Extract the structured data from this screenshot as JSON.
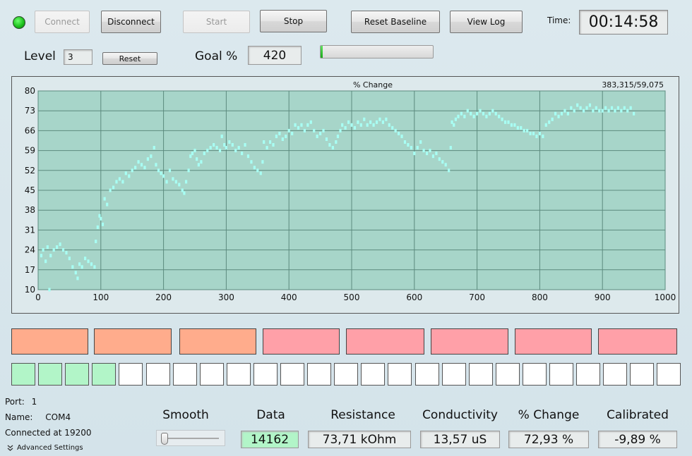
{
  "status": {
    "led_icon": "green-led-icon",
    "led_color": "#1ec21e"
  },
  "toolbar": {
    "connect": "Connect",
    "disconnect": "Disconnect",
    "start": "Start",
    "stop": "Stop",
    "reset_baseline": "Reset Baseline",
    "view_log": "View Log",
    "time_label": "Time:",
    "time_value": "00:14:58"
  },
  "level": {
    "label": "Level",
    "value": "3",
    "reset": "Reset"
  },
  "goal": {
    "label": "Goal %",
    "value": "420",
    "progress_percent": 2
  },
  "chart_data": {
    "type": "scatter",
    "title": "% Change",
    "annotation": "383,315/59,075",
    "xlim": [
      0,
      1000
    ],
    "ylim": [
      10,
      80
    ],
    "x_ticks": [
      0,
      100,
      200,
      300,
      400,
      500,
      600,
      700,
      800,
      900,
      1000
    ],
    "y_ticks": [
      10,
      17,
      24,
      31,
      38,
      45,
      52,
      59,
      66,
      73,
      80
    ],
    "grid": true,
    "series": [
      {
        "color": "#a8fff4",
        "points": [
          [
            5,
            22
          ],
          [
            8,
            24
          ],
          [
            12,
            20
          ],
          [
            15,
            25
          ],
          [
            18,
            10
          ],
          [
            20,
            22
          ],
          [
            25,
            24
          ],
          [
            30,
            25
          ],
          [
            35,
            26
          ],
          [
            40,
            24
          ],
          [
            45,
            23
          ],
          [
            50,
            21
          ],
          [
            55,
            18
          ],
          [
            60,
            16
          ],
          [
            63,
            14
          ],
          [
            66,
            19
          ],
          [
            70,
            18
          ],
          [
            75,
            21
          ],
          [
            80,
            20
          ],
          [
            85,
            19
          ],
          [
            90,
            18
          ],
          [
            92,
            27
          ],
          [
            95,
            32
          ],
          [
            98,
            36
          ],
          [
            100,
            35
          ],
          [
            103,
            33
          ],
          [
            106,
            42
          ],
          [
            110,
            40
          ],
          [
            115,
            45
          ],
          [
            120,
            46
          ],
          [
            125,
            48
          ],
          [
            130,
            49
          ],
          [
            135,
            48
          ],
          [
            140,
            51
          ],
          [
            145,
            50
          ],
          [
            150,
            52
          ],
          [
            155,
            53
          ],
          [
            160,
            55
          ],
          [
            165,
            54
          ],
          [
            170,
            53
          ],
          [
            175,
            56
          ],
          [
            180,
            57
          ],
          [
            185,
            60
          ],
          [
            188,
            54
          ],
          [
            192,
            52
          ],
          [
            196,
            51
          ],
          [
            200,
            50
          ],
          [
            205,
            48
          ],
          [
            210,
            52
          ],
          [
            215,
            49
          ],
          [
            220,
            48
          ],
          [
            225,
            47
          ],
          [
            230,
            45
          ],
          [
            233,
            44
          ],
          [
            236,
            48
          ],
          [
            240,
            52
          ],
          [
            243,
            57
          ],
          [
            246,
            58
          ],
          [
            250,
            59
          ],
          [
            253,
            56
          ],
          [
            256,
            54
          ],
          [
            260,
            55
          ],
          [
            265,
            58
          ],
          [
            270,
            59
          ],
          [
            275,
            60
          ],
          [
            280,
            61
          ],
          [
            285,
            60
          ],
          [
            290,
            59
          ],
          [
            293,
            64
          ],
          [
            297,
            61
          ],
          [
            300,
            60
          ],
          [
            305,
            62
          ],
          [
            310,
            61
          ],
          [
            315,
            59
          ],
          [
            320,
            60
          ],
          [
            325,
            58
          ],
          [
            330,
            61
          ],
          [
            335,
            57
          ],
          [
            340,
            55
          ],
          [
            345,
            53
          ],
          [
            350,
            52
          ],
          [
            355,
            51
          ],
          [
            358,
            55
          ],
          [
            360,
            62
          ],
          [
            365,
            60
          ],
          [
            370,
            62
          ],
          [
            375,
            61
          ],
          [
            380,
            64
          ],
          [
            385,
            65
          ],
          [
            390,
            63
          ],
          [
            395,
            64
          ],
          [
            400,
            66
          ],
          [
            405,
            65
          ],
          [
            410,
            68
          ],
          [
            415,
            67
          ],
          [
            420,
            68
          ],
          [
            425,
            66
          ],
          [
            430,
            68
          ],
          [
            435,
            69
          ],
          [
            440,
            66
          ],
          [
            445,
            64
          ],
          [
            450,
            65
          ],
          [
            455,
            66
          ],
          [
            460,
            63
          ],
          [
            465,
            61
          ],
          [
            470,
            60
          ],
          [
            475,
            62
          ],
          [
            478,
            64
          ],
          [
            482,
            66
          ],
          [
            485,
            68
          ],
          [
            490,
            67
          ],
          [
            495,
            69
          ],
          [
            500,
            68
          ],
          [
            505,
            67
          ],
          [
            510,
            69
          ],
          [
            515,
            68
          ],
          [
            520,
            70
          ],
          [
            525,
            68
          ],
          [
            530,
            69
          ],
          [
            535,
            68
          ],
          [
            540,
            69
          ],
          [
            545,
            70
          ],
          [
            550,
            69
          ],
          [
            555,
            70
          ],
          [
            560,
            68
          ],
          [
            565,
            67
          ],
          [
            570,
            66
          ],
          [
            575,
            65
          ],
          [
            580,
            64
          ],
          [
            585,
            62
          ],
          [
            590,
            61
          ],
          [
            595,
            60
          ],
          [
            600,
            58
          ],
          [
            605,
            60
          ],
          [
            610,
            62
          ],
          [
            615,
            59
          ],
          [
            620,
            58
          ],
          [
            625,
            59
          ],
          [
            630,
            57
          ],
          [
            635,
            58
          ],
          [
            640,
            56
          ],
          [
            645,
            55
          ],
          [
            650,
            54
          ],
          [
            655,
            52
          ],
          [
            658,
            60
          ],
          [
            660,
            69
          ],
          [
            663,
            68
          ],
          [
            666,
            70
          ],
          [
            670,
            71
          ],
          [
            675,
            72
          ],
          [
            680,
            71
          ],
          [
            685,
            73
          ],
          [
            690,
            72
          ],
          [
            695,
            71
          ],
          [
            700,
            72
          ],
          [
            705,
            73
          ],
          [
            710,
            72
          ],
          [
            715,
            71
          ],
          [
            720,
            72
          ],
          [
            725,
            73
          ],
          [
            730,
            72
          ],
          [
            735,
            71
          ],
          [
            740,
            70
          ],
          [
            745,
            69
          ],
          [
            750,
            69
          ],
          [
            755,
            68
          ],
          [
            760,
            68
          ],
          [
            765,
            67
          ],
          [
            770,
            67
          ],
          [
            775,
            66
          ],
          [
            780,
            66
          ],
          [
            785,
            65
          ],
          [
            790,
            65
          ],
          [
            795,
            64
          ],
          [
            800,
            65
          ],
          [
            805,
            64
          ],
          [
            810,
            68
          ],
          [
            815,
            69
          ],
          [
            820,
            70
          ],
          [
            825,
            72
          ],
          [
            830,
            71
          ],
          [
            835,
            72
          ],
          [
            840,
            73
          ],
          [
            845,
            72
          ],
          [
            850,
            74
          ],
          [
            855,
            73
          ],
          [
            860,
            75
          ],
          [
            865,
            74
          ],
          [
            870,
            73
          ],
          [
            875,
            74
          ],
          [
            880,
            75
          ],
          [
            885,
            73
          ],
          [
            890,
            74
          ],
          [
            895,
            73
          ],
          [
            900,
            73
          ],
          [
            905,
            74
          ],
          [
            910,
            73
          ],
          [
            915,
            74
          ],
          [
            920,
            73
          ],
          [
            925,
            74
          ],
          [
            930,
            73
          ],
          [
            935,
            74
          ],
          [
            940,
            73
          ],
          [
            945,
            74
          ],
          [
            950,
            72
          ]
        ]
      }
    ]
  },
  "tiles": [
    {
      "color": "#ffac8c"
    },
    {
      "color": "#ffac8c"
    },
    {
      "color": "#ffac8c"
    },
    {
      "color": "#ffa0a8"
    },
    {
      "color": "#ffa0a8"
    },
    {
      "color": "#ffa0a8"
    },
    {
      "color": "#ffa0a8"
    },
    {
      "color": "#ffa0a8"
    }
  ],
  "level_cells": {
    "total": 25,
    "active": 4,
    "active_color": "#b2f5c8"
  },
  "connection": {
    "port_label": "Port:",
    "port_value": "1",
    "name_label": "Name:",
    "name_value": "COM4",
    "connected_text": "Connected at 19200",
    "advanced": "Advanced Settings",
    "advanced_icon": "double-chevron-down-icon"
  },
  "stats": {
    "smooth_label": "Smooth",
    "data_label": "Data",
    "data_value": "14162",
    "resistance_label": "Resistance",
    "resistance_value": "73,71 kOhm",
    "conductivity_label": "Conductivity",
    "conductivity_value": "13,57 uS",
    "change_label": "% Change",
    "change_value": "72,93 %",
    "calibrated_label": "Calibrated",
    "calibrated_value": "-9,89 %"
  }
}
